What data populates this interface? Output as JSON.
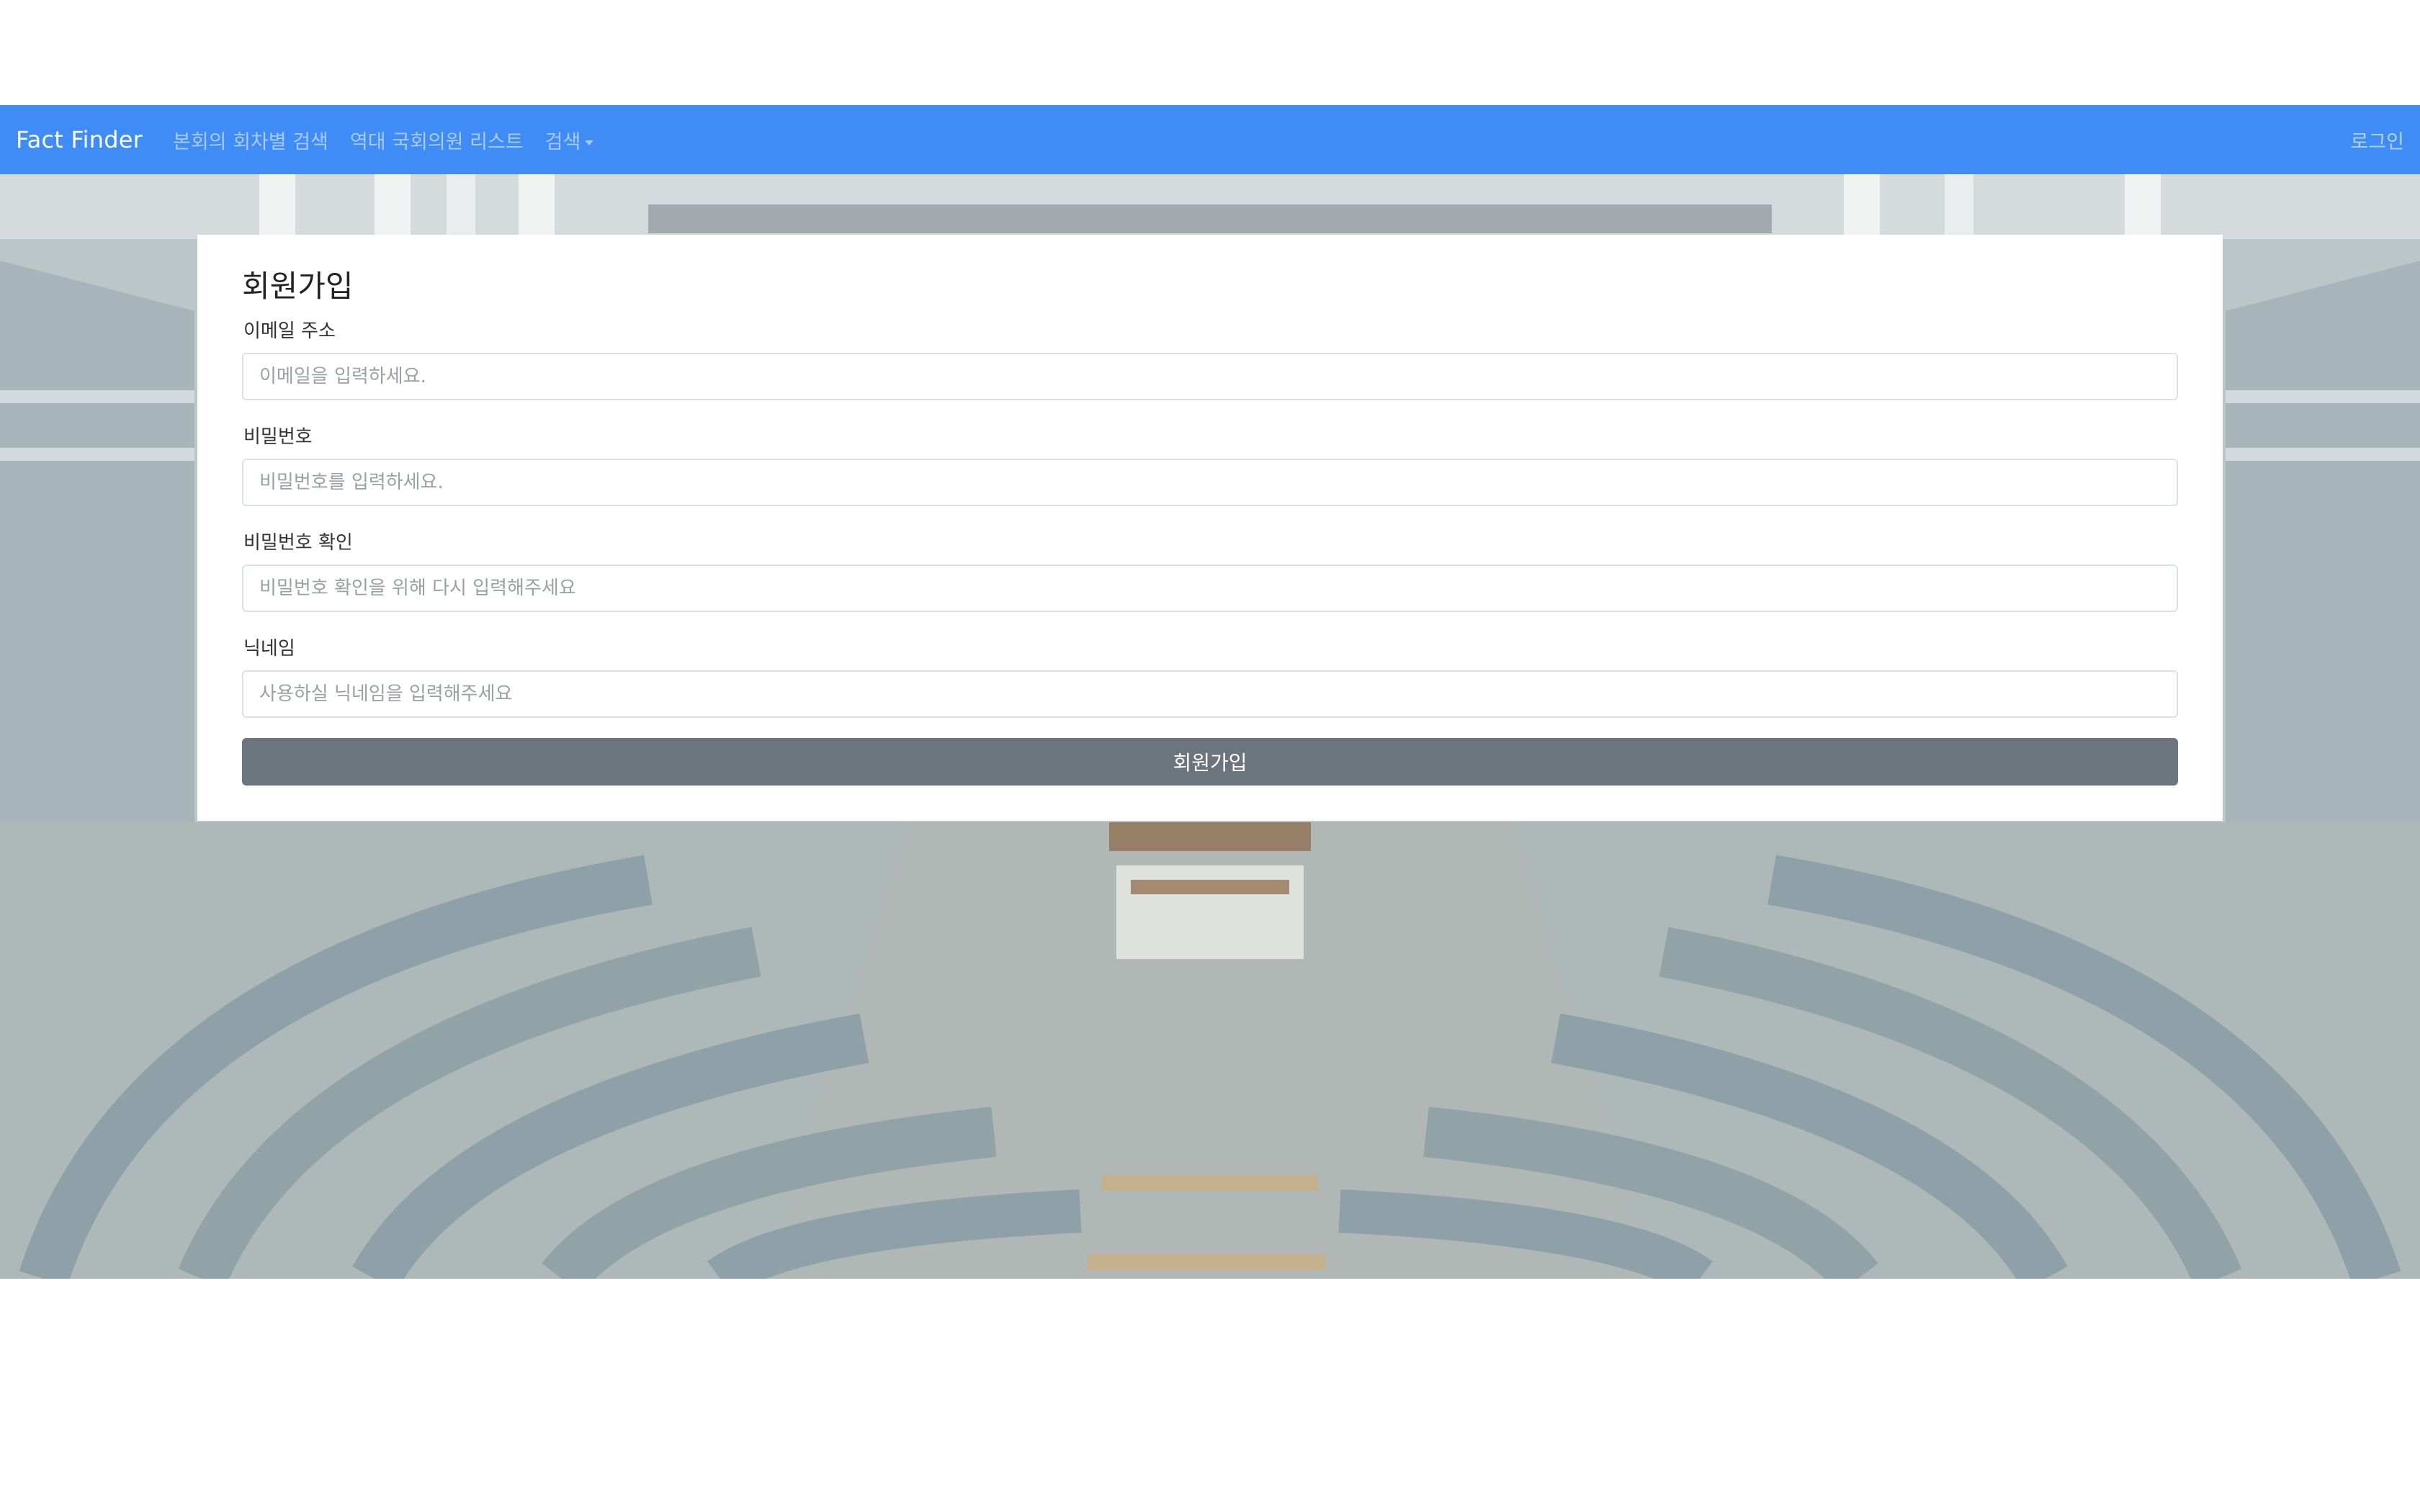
{
  "navbar": {
    "brand": "Fact Finder",
    "links": [
      {
        "label": "본회의 회차별 검색"
      },
      {
        "label": "역대 국회의원 리스트"
      },
      {
        "label": "검색"
      }
    ],
    "login": "로그인"
  },
  "signup": {
    "title": "회원가입",
    "email": {
      "label": "이메일 주소",
      "placeholder": "이메일을 입력하세요."
    },
    "password": {
      "label": "비밀번호",
      "placeholder": "비밀번호를 입력하세요."
    },
    "password_confirm": {
      "label": "비밀번호 확인",
      "placeholder": "비밀번호 확인을 위해 다시 입력해주세요"
    },
    "nickname": {
      "label": "닉네임",
      "placeholder": "사용하실 닉네임을 입력해주세요"
    },
    "submit": "회원가입"
  },
  "colors": {
    "navbar": "#3f8cf6",
    "button": "#6c757d",
    "card": "#ffffff"
  },
  "background_image": "parliament chamber"
}
